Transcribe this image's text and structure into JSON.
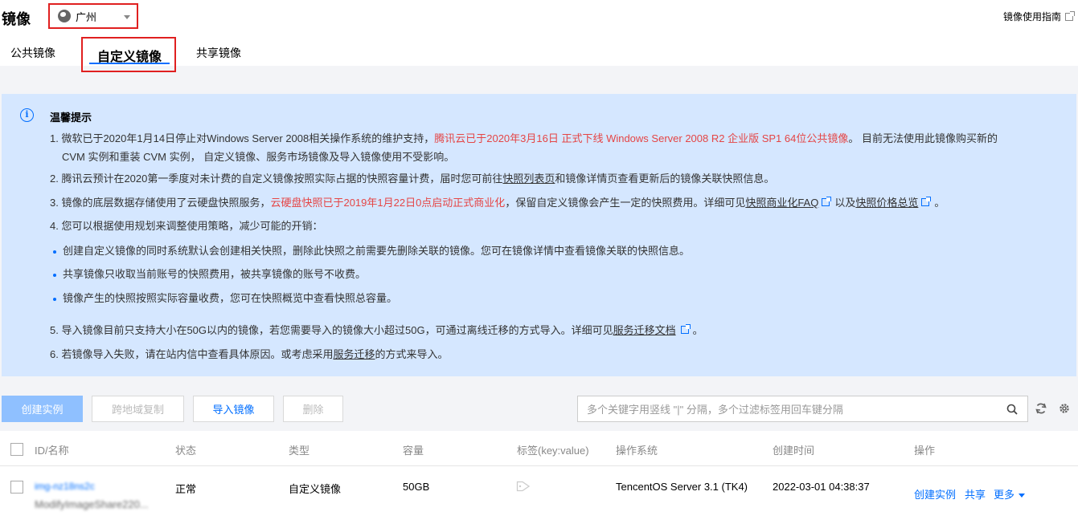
{
  "header": {
    "title": "镜像",
    "region": "广州",
    "guide_link": "镜像使用指南"
  },
  "tabs": [
    {
      "label": "公共镜像",
      "active": false
    },
    {
      "label": "自定义镜像",
      "active": true
    },
    {
      "label": "共享镜像",
      "active": false
    }
  ],
  "notice": {
    "title": "温馨提示",
    "l1_a": "1. 微软已于2020年1月14日停止对Windows Server 2008相关操作系统的维护支持，",
    "l1_red": "腾讯云已于2020年3月16日 正式下线 Windows Server 2008 R2 企业版 SP1 64位公共镜像",
    "l1_b": "。 目前无法使用此镜像购买新的",
    "l1_c": "CVM 实例和重装 CVM 实例， 自定义镜像、服务市场镜像及导入镜像使用不受影响。",
    "l2_a": "2. 腾讯云预计在2020第一季度对未计费的自定义镜像按照实际占据的快照容量计费，届时您可前往",
    "l2_link": "快照列表页",
    "l2_b": "和镜像详情页查看更新后的镜像关联快照信息。",
    "l3_a": "3. 镜像的底层数据存储使用了云硬盘快照服务，",
    "l3_red": "云硬盘快照已于2019年1月22日0点启动正式商业化",
    "l3_b": "，保留自定义镜像会产生一定的快照费用。详细可见",
    "l3_link1": "快照商业化FAQ",
    "l3_c": "以及",
    "l3_link2": "快照价格总览",
    "l3_d": "。",
    "l4": "4. 您可以根据使用规划来调整使用策略，减少可能的开销：",
    "b1": "创建自定义镜像的同时系统默认会创建相关快照，删除此快照之前需要先删除关联的镜像。您可在镜像详情中查看镜像关联的快照信息。",
    "b2": "共享镜像只收取当前账号的快照费用，被共享镜像的账号不收费。",
    "b3": "镜像产生的快照按照实际容量收费，您可在快照概览中查看快照总容量。",
    "l5_a": "5. 导入镜像目前只支持大小在50G以内的镜像，若您需要导入的镜像大小超过50G，可通过离线迁移的方式导入。详细可见",
    "l5_link": "服务迁移文档",
    "l5_b": "。",
    "l6_a": "6. 若镜像导入失败，请在站内信中查看具体原因。或考虑采用",
    "l6_link": "服务迁移",
    "l6_b": "的方式来导入。"
  },
  "toolbar": {
    "create_instance": "创建实例",
    "cross_region_copy": "跨地域复制",
    "import_image": "导入镜像",
    "delete": "删除",
    "search_placeholder": "多个关键字用竖线 \"|\" 分隔，多个过滤标签用回车键分隔"
  },
  "table": {
    "columns": [
      "ID/名称",
      "状态",
      "类型",
      "容量",
      "标签(key:value)",
      "操作系统",
      "创建时间",
      "操作"
    ],
    "rows": [
      {
        "id": "img-nz18ns2c",
        "name": "ModifyImageShare220...",
        "status": "正常",
        "type": "自定义镜像",
        "capacity": "50GB",
        "os": "TencentOS Server 3.1 (TK4)",
        "created": "2022-03-01 04:38:37",
        "actions": {
          "create": "创建实例",
          "share": "共享",
          "more": "更多"
        }
      }
    ]
  },
  "colors": {
    "accent": "#006eff",
    "notice_bg": "#d5e7ff",
    "warning_red": "#e54545",
    "highlight_box": "#e02020"
  }
}
